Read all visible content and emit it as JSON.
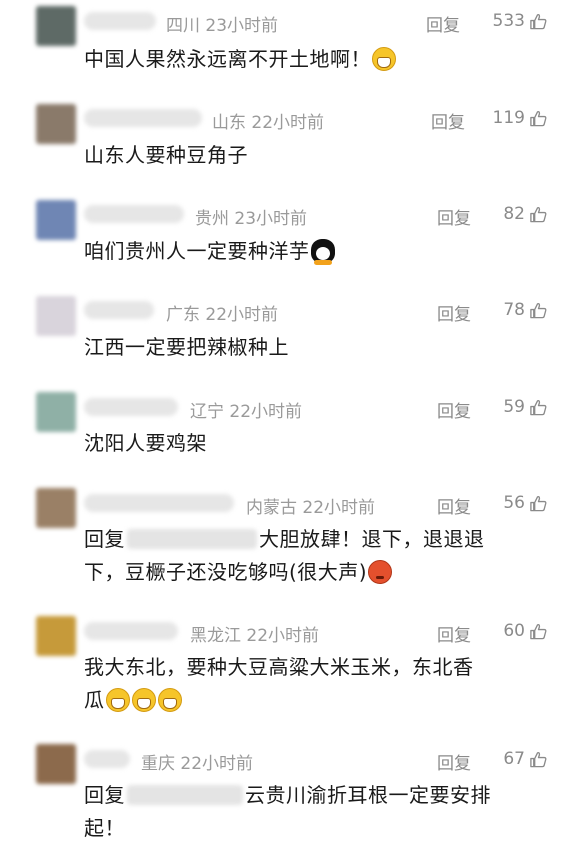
{
  "reply_label": "回复",
  "comments": [
    {
      "region": "四川",
      "time": "23小时前",
      "likes": "533",
      "text": "中国人果然永远离不开土地啊！",
      "avatar_color": "#5e6a66"
    },
    {
      "region": "山东",
      "time": "22小时前",
      "likes": "119",
      "text": "山东人要种豆角子",
      "avatar_color": "#8a7a6a"
    },
    {
      "region": "贵州",
      "time": "23小时前",
      "likes": "82",
      "text": "咱们贵州人一定要种洋芋",
      "avatar_color": "#6f86b4"
    },
    {
      "region": "广东",
      "time": "22小时前",
      "likes": "78",
      "text": "江西一定要把辣椒种上",
      "avatar_color": "#d9d4dc"
    },
    {
      "region": "辽宁",
      "time": "22小时前",
      "likes": "59",
      "text": "沈阳人要鸡架",
      "avatar_color": "#8fb0a6"
    },
    {
      "region": "内蒙古",
      "time": "22小时前",
      "likes": "56",
      "text_prefix": "回复",
      "text_line1": "大胆放肆！退下，退退退",
      "text_line2": "下，豆橛子还没吃够吗(很大声)",
      "avatar_color": "#9a8066"
    },
    {
      "region": "黑龙江",
      "time": "22小时前",
      "likes": "60",
      "text_line1": "我大东北，要种大豆高粱大米玉米，东北香",
      "text_line2": "瓜",
      "avatar_color": "#c69a3a"
    },
    {
      "region": "重庆",
      "time": "22小时前",
      "likes": "67",
      "text_prefix": "回复",
      "text_line1": "云贵川渝折耳根一定要安排",
      "text_line2": "起！",
      "avatar_color": "#8c6a4c"
    }
  ]
}
